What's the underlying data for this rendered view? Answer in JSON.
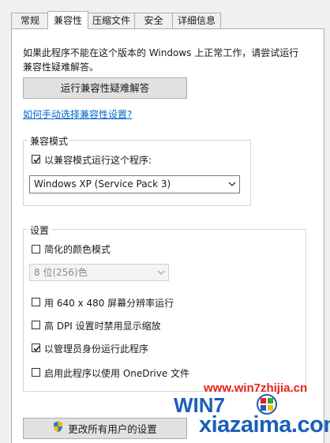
{
  "tabs": [
    {
      "label": "常规",
      "active": false
    },
    {
      "label": "兼容性",
      "active": true
    },
    {
      "label": "压缩文件",
      "active": false
    },
    {
      "label": "安全",
      "active": false
    },
    {
      "label": "详细信息",
      "active": false
    }
  ],
  "intro_text": "如果此程序不能在这个版本的 Windows 上正常工作，请尝试运行兼容性疑难解答。",
  "troubleshooter_button": "运行兼容性疑难解答",
  "manual_link": "如何手动选择兼容性设置?",
  "compat_mode": {
    "legend": "兼容模式",
    "checkbox_label": "以兼容模式运行这个程序:",
    "checked": true,
    "selected_os": "Windows XP (Service Pack 3)"
  },
  "settings": {
    "legend": "设置",
    "reduced_color": {
      "label": "简化的颜色模式",
      "checked": false
    },
    "color_select": "8 位(256)色",
    "res_640": {
      "label": "用 640 x 480 屏幕分辨率运行",
      "checked": false
    },
    "high_dpi": {
      "label": "高 DPI 设置时禁用显示缩放",
      "checked": false
    },
    "run_admin": {
      "label": "以管理员身份运行此程序",
      "checked": true
    },
    "onedrive": {
      "label": "启用此程序以使用 OneDrive 文件",
      "checked": false
    }
  },
  "change_all_button": "更改所有用户的设置",
  "watermark": {
    "url": "www.win7zhijia.cn",
    "brand": "xiazaima.com"
  },
  "colors": {
    "link": "#0066cc",
    "watermark_red": "#e8201a",
    "watermark_blue": "#1b5fb8"
  }
}
